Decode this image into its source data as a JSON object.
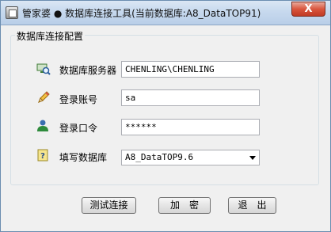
{
  "window": {
    "title": "管家婆 ● 数据库连接工具(当前数据库:A8_DataTOP91)",
    "close_glyph": "X"
  },
  "group": {
    "title": "数据库连接配置"
  },
  "fields": {
    "server": {
      "label": "数据库服务器",
      "value": "CHENLING\\CHENLING",
      "icon": "computer-search-icon"
    },
    "account": {
      "label": "登录账号",
      "value": "sa",
      "icon": "pencil-icon"
    },
    "password": {
      "label": "登录口令",
      "value": "******",
      "icon": "user-icon"
    },
    "database": {
      "label": "填写数据库",
      "value": "A8_DataTOP9.6",
      "icon": "help-icon"
    }
  },
  "buttons": {
    "test": "测试连接",
    "encrypt": "加　密",
    "exit": "退　出"
  }
}
